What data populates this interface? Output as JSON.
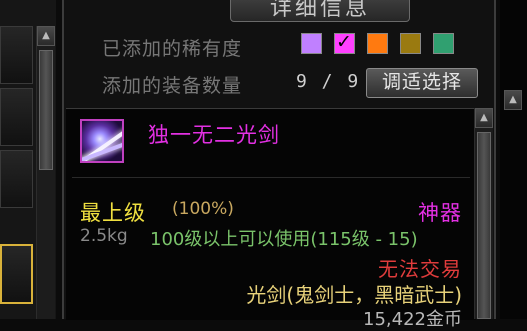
{
  "window": {
    "title": "详细信息"
  },
  "rarity_filter": {
    "label": "已添加的稀有度",
    "swatches": [
      {
        "name": "purple",
        "color": "#c080ff",
        "checked": false
      },
      {
        "name": "pink-checked",
        "color": "#ff40ff",
        "checked": true
      },
      {
        "name": "orange",
        "color": "#ff7a10",
        "checked": false
      },
      {
        "name": "olive",
        "color": "#9a7a10",
        "checked": false
      },
      {
        "name": "teal",
        "color": "#30a070",
        "checked": false
      }
    ],
    "check_glyph": "✓"
  },
  "equipment_count": {
    "label": "添加的装备数量",
    "value": "9 / 9",
    "button_label": "调适选择"
  },
  "item": {
    "icon": "lightsaber-item-icon",
    "name": "独一无二光剑",
    "grade": "最上级",
    "grade_percent": "(100%)",
    "rarity": "神器",
    "weight": "2.5kg",
    "level_requirement": "100级以上可以使用(115级 - 15)",
    "trade_status": "无法交易",
    "classes": "光剑(鬼剑士，黑暗武士)",
    "price": "15,422金币"
  },
  "scroll": {
    "up_glyph": "▲"
  }
}
